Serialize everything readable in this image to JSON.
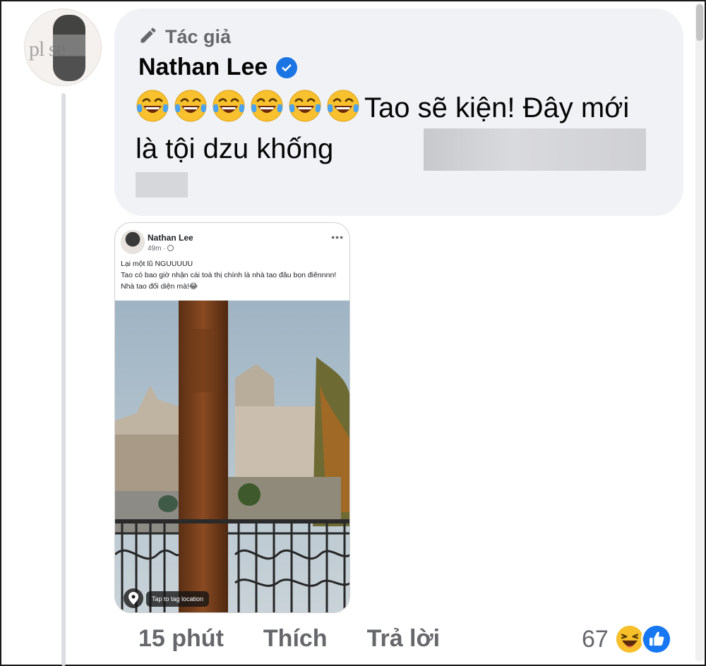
{
  "comment": {
    "author_badge": "Tác giả",
    "author_name": "Nathan Lee",
    "verified": true,
    "avatar_text": "pl se",
    "text": "Tao sẽ kiện! Đây mới là tội dzu khống",
    "emoji_count": 6,
    "emoji_icon": "laughing-tears-emoji"
  },
  "shared_post": {
    "author": "Nathan Lee",
    "time": "49m ·",
    "line1": "Lại một lũ NGUUUUU",
    "line2": "Tao có bao giờ nhận cái toà thị chính là nhà tao đâu bọn điênnnn! Nhà tao đối diện mà!😂",
    "tag_location": "Tap to tag location"
  },
  "actions": {
    "time": "15 phút",
    "like": "Thích",
    "reply": "Trả lời"
  },
  "reactions": {
    "count": "67",
    "icons": [
      "haha-reaction-icon",
      "like-reaction-icon"
    ]
  },
  "colors": {
    "bubble": "#f0f2f5",
    "secondary_text": "#65676b",
    "verified_blue": "#1b74e4"
  }
}
